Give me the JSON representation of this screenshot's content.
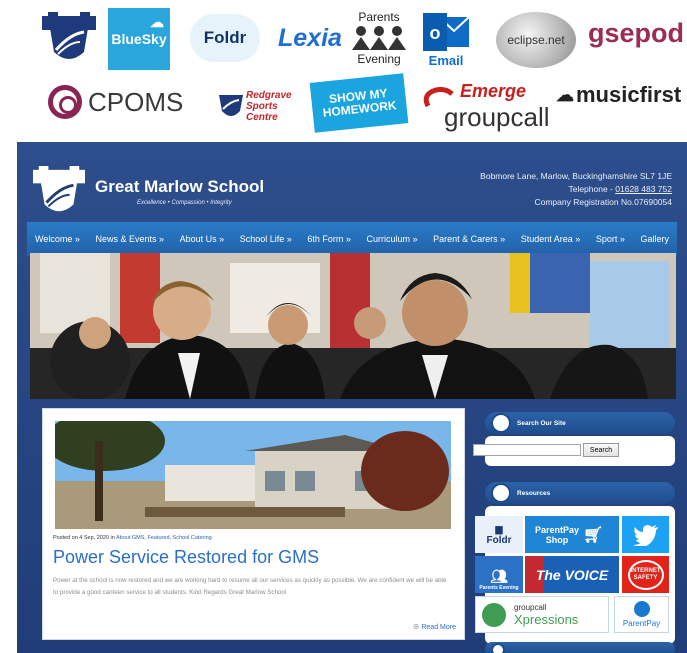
{
  "logos": {
    "bluesky": "BlueSky",
    "foldr": "Foldr",
    "lexia": "Lexia",
    "parents_evening_top": "Parents",
    "parents_evening_bottom": "Evening",
    "email": "Email",
    "eclipse": "eclipse.net",
    "gsepod": "gsepod",
    "cpoms": "CPOMS",
    "redgrave": "Redgrave Sports Centre",
    "show_my_homework": "SHOW MY HOMEWORK",
    "emerge": "Emerge",
    "groupcall": "groupcall",
    "musicfirst": "musicfirst"
  },
  "site": {
    "name": "Great Marlow School",
    "tagline": "Excellence • Compassion • Integrity",
    "address_line": "Bobmore Lane, Marlow, Buckinghamshire SL7 1JE",
    "telephone_label": "Telephone - ",
    "telephone": "01628 483 752",
    "company_reg": "Company Registration No.07690054"
  },
  "nav": {
    "items": [
      "Welcome »",
      "News & Events »",
      "About Us »",
      "School Life »",
      "6th Form »",
      "Curriculum »",
      "Parent & Carers »",
      "Student Area »",
      "Sport »",
      "Gallery"
    ]
  },
  "post": {
    "posted_prefix": "Posted on 4 Sep, 2020 in ",
    "categories": "About GMS, Featured, School Catering",
    "title": "Power Service Restored for GMS",
    "body": "Power at the school is now restored and we are working hard to resume all our services as quickly as possible. We are confident we will be able to provide a good canteen service to all students. Kind Regards Great Marlow School",
    "read_more": "Read More"
  },
  "sidebar": {
    "search_title": "Search Our Site",
    "search_button": "Search",
    "resources_title": "Resources",
    "tiles": {
      "foldr": "Foldr",
      "parentpay_shop": "ParentPay Shop",
      "parents_evening": "Parents Evening",
      "the_voice": "The VOICE",
      "internet_safety": "INTERNET SAFETY",
      "groupcall_top": "groupcall",
      "groupcall_bottom": "Xpressions",
      "parentpay": "ParentPay"
    }
  },
  "colors": {
    "site_blue": "#203d78",
    "nav_blue": "#2a7cc8",
    "title_blue": "#2a6fc4",
    "lexia_blue": "#1f6fd1",
    "cpoms_purple": "#8a2553"
  }
}
